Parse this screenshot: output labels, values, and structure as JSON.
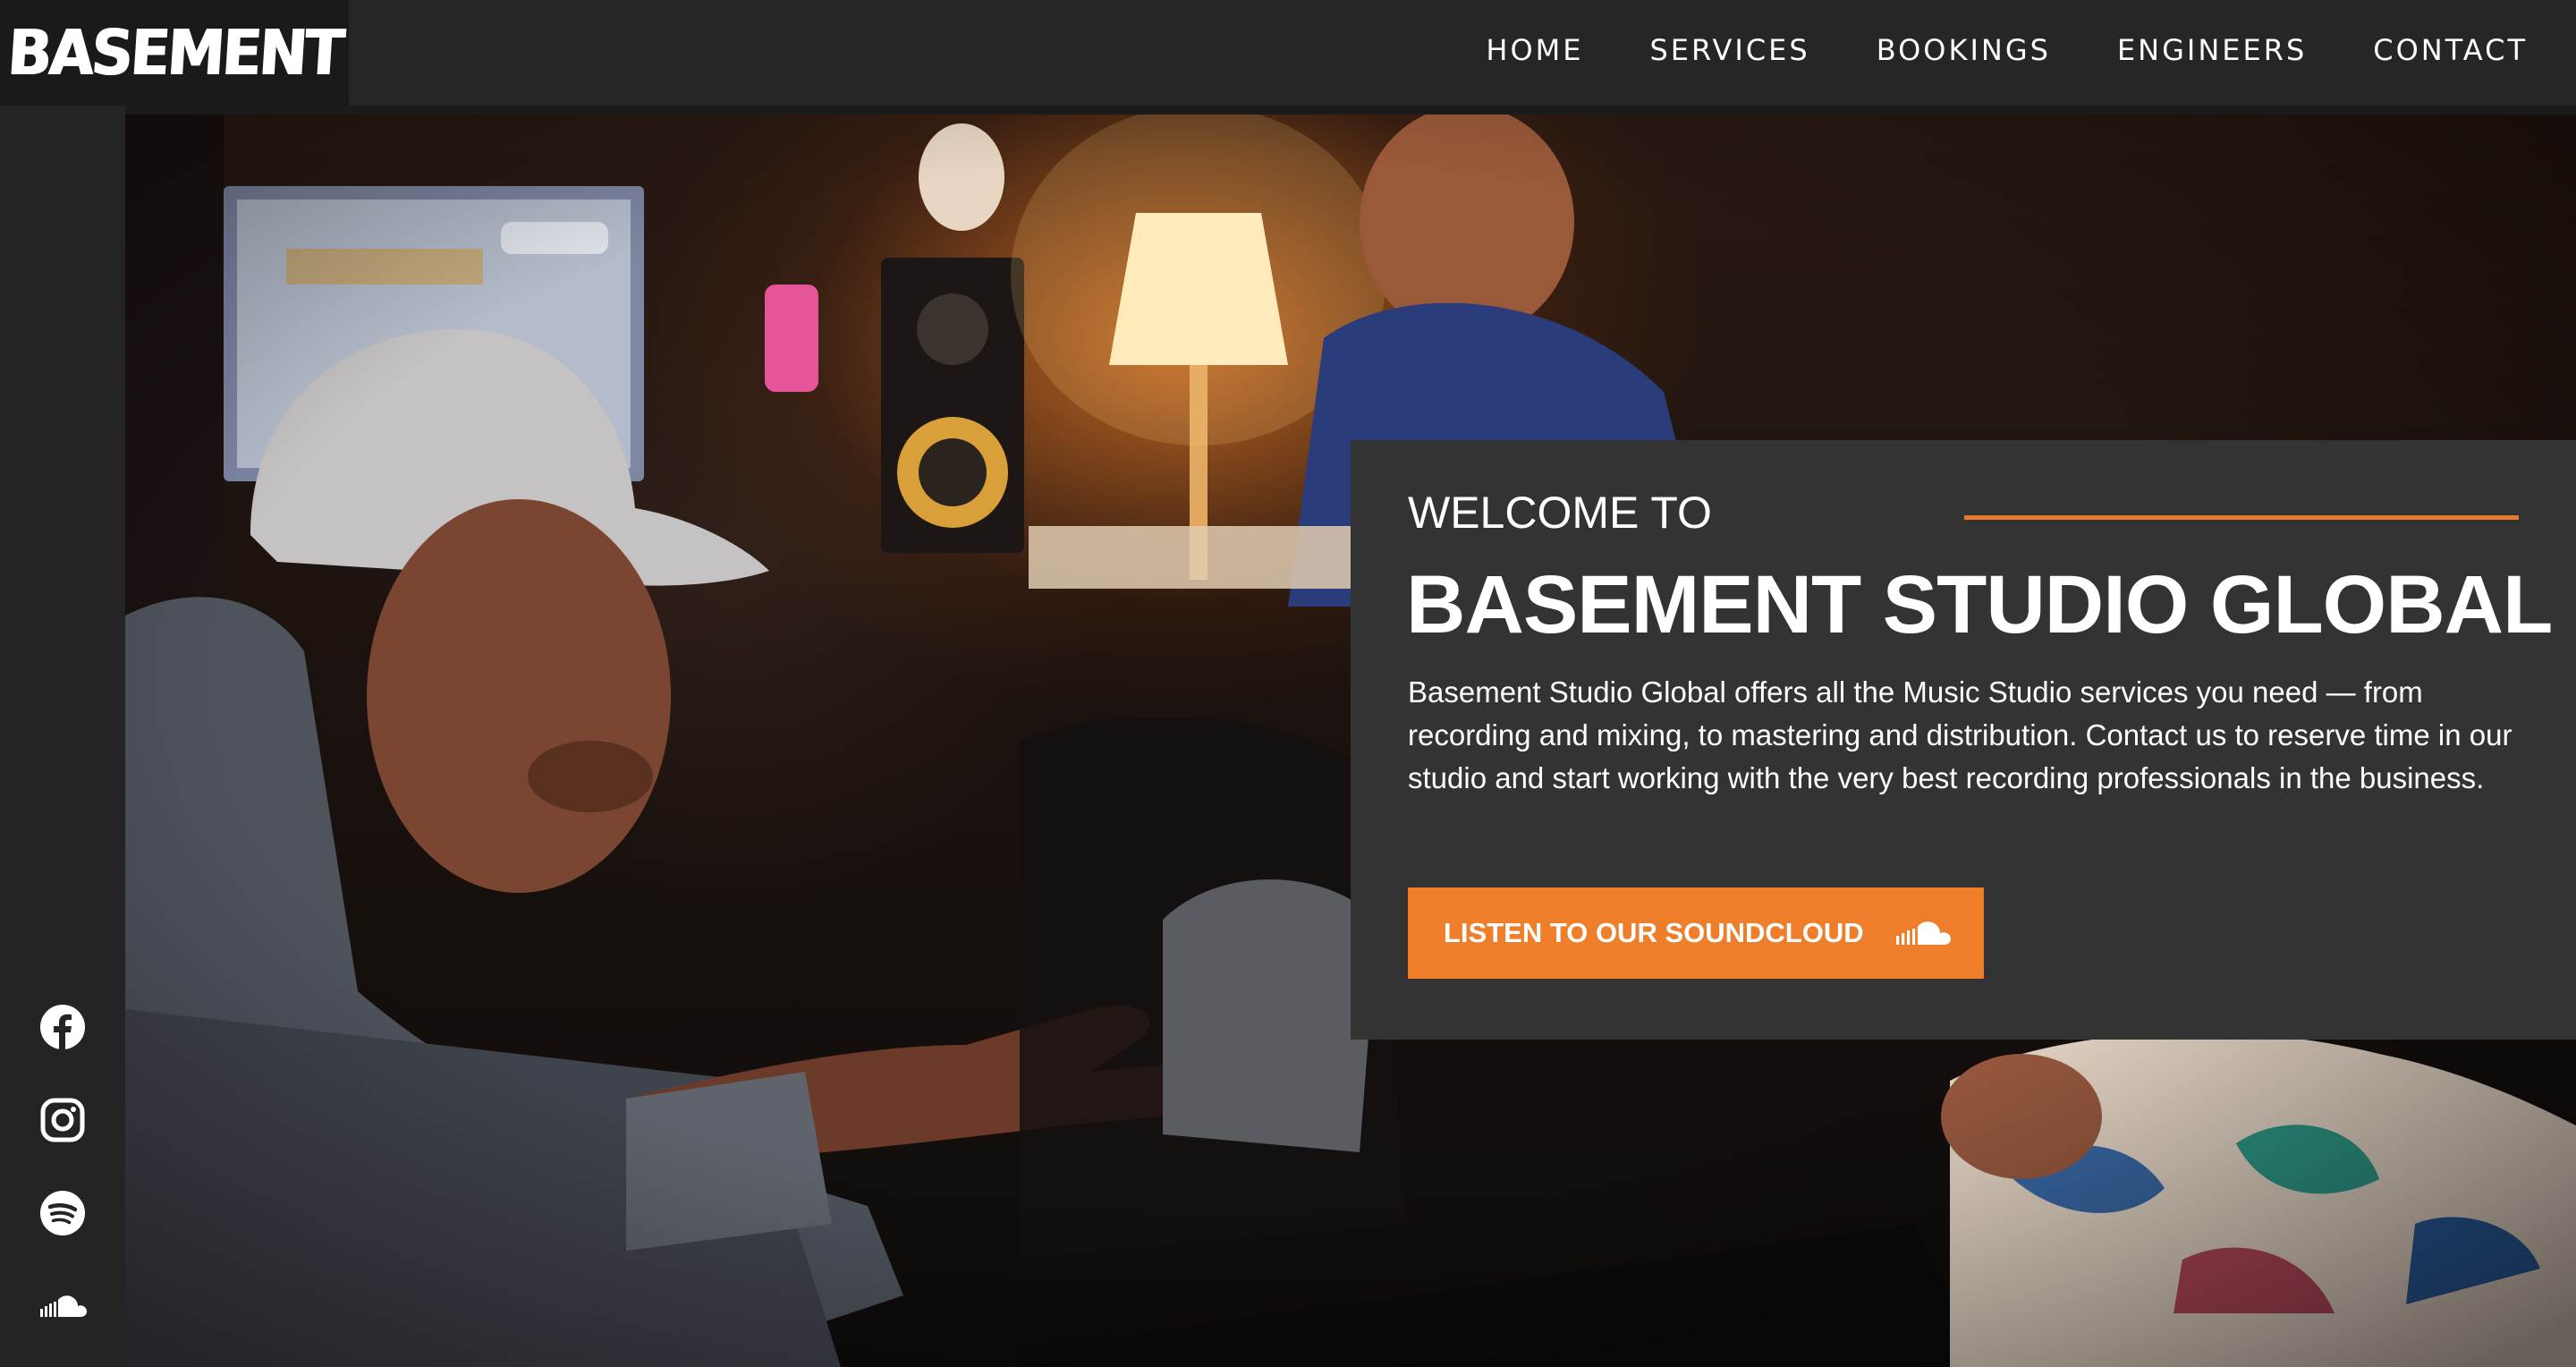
{
  "brand": {
    "logo_text": "BASEMENT"
  },
  "nav": {
    "items": [
      {
        "label": "HOME"
      },
      {
        "label": "SERVICES"
      },
      {
        "label": "BOOKINGS"
      },
      {
        "label": "ENGINEERS"
      },
      {
        "label": "CONTACT"
      }
    ]
  },
  "sidebar": {
    "social": [
      {
        "icon": "facebook-icon"
      },
      {
        "icon": "instagram-icon"
      },
      {
        "icon": "spotify-icon"
      },
      {
        "icon": "soundcloud-icon"
      }
    ]
  },
  "hero": {
    "pretitle": "WELCOME TO",
    "title": "BASEMENT STUDIO GLOBAL",
    "body": "Basement Studio Global offers all the Music Studio services you need — from recording and mixing, to mastering and distribution. Contact us to reserve time in our studio and start working with the very best recording professionals in the business.",
    "cta_label": "LISTEN TO OUR SOUNDCLOUD",
    "cta_icon": "soundcloud-icon"
  },
  "colors": {
    "accent": "#ef7e2a",
    "header": "#262626",
    "panel": "#333333"
  }
}
